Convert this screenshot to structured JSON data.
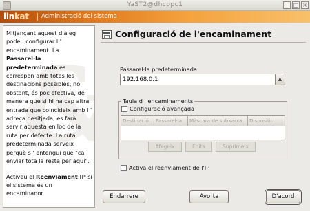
{
  "window": {
    "title": "YaST2@dhcppc1",
    "minimize": "_",
    "maximize": "□",
    "close": "×"
  },
  "banner": {
    "logo_main": "lin",
    "logo_accent": "kat",
    "subtitle": "Administració del sistema"
  },
  "help": {
    "p1_a": "Mitjançant aquest diàleg podeu configurar l ' encaminament. La ",
    "p1_bold": "Passarel·la predeterminada",
    "p1_b": " es correspon amb totes les destinacions possibles, no obstant, és poc efectiva, de manera que si hi ha cap altra entrada que coincideix amb l ' adreça desitjada, es farà servir aquesta enlloc de la ruta per defecte. La ruta predeterminada serveix perquè s ' entengui que \"cal enviar tota la resta per aquí\".",
    "p2_a": "Activeu el ",
    "p2_bold": "Reenviament IP",
    "p2_b": " si el sistema és un encaminador."
  },
  "main": {
    "heading": "Configuració de l'encaminament",
    "gateway_label": "Passarel·la predeterminada",
    "gateway_value": "192.168.0.1",
    "routing_table_title": "Taula d ' encaminaments",
    "advanced_label": "Configuració avançada",
    "columns": [
      "Destinació",
      "Passarel·la",
      "Màscara de subxarxa",
      "Dispositiu"
    ],
    "table_buttons": [
      "Afegeix",
      "Edita",
      "Suprimeix"
    ],
    "ip_forward_label": "Activa el reenviament de l'IP"
  },
  "buttons": {
    "back": "Endarrere",
    "abort": "Avorta",
    "accept": "D'acord"
  }
}
